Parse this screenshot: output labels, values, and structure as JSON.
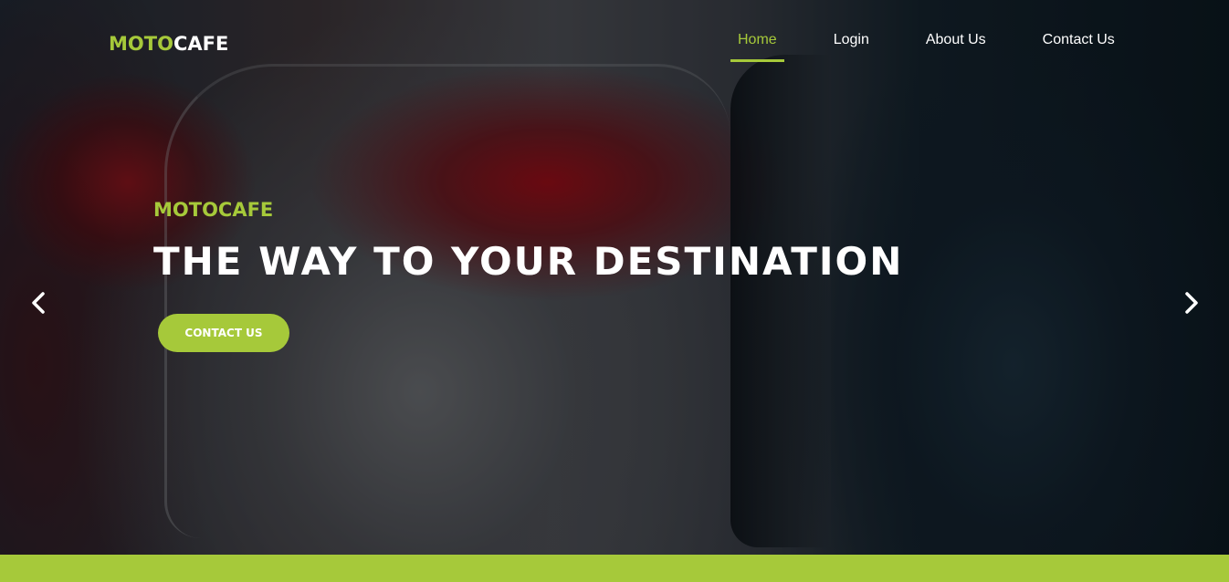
{
  "brand": {
    "accent": "MOTO",
    "rest": "CAFE"
  },
  "nav": {
    "items": [
      {
        "label": "Home",
        "active": true
      },
      {
        "label": "Login",
        "active": false
      },
      {
        "label": "About Us",
        "active": false
      },
      {
        "label": "Contact Us",
        "active": false
      }
    ]
  },
  "hero": {
    "eyebrow": "MOTOCAFE",
    "headline": "THE WAY TO YOUR DESTINATION",
    "cta_label": "CONTACT US",
    "prev_icon": "chevron-left-icon",
    "next_icon": "chevron-right-icon"
  },
  "colors": {
    "accent": "#a6c93a",
    "text": "#ffffff"
  }
}
